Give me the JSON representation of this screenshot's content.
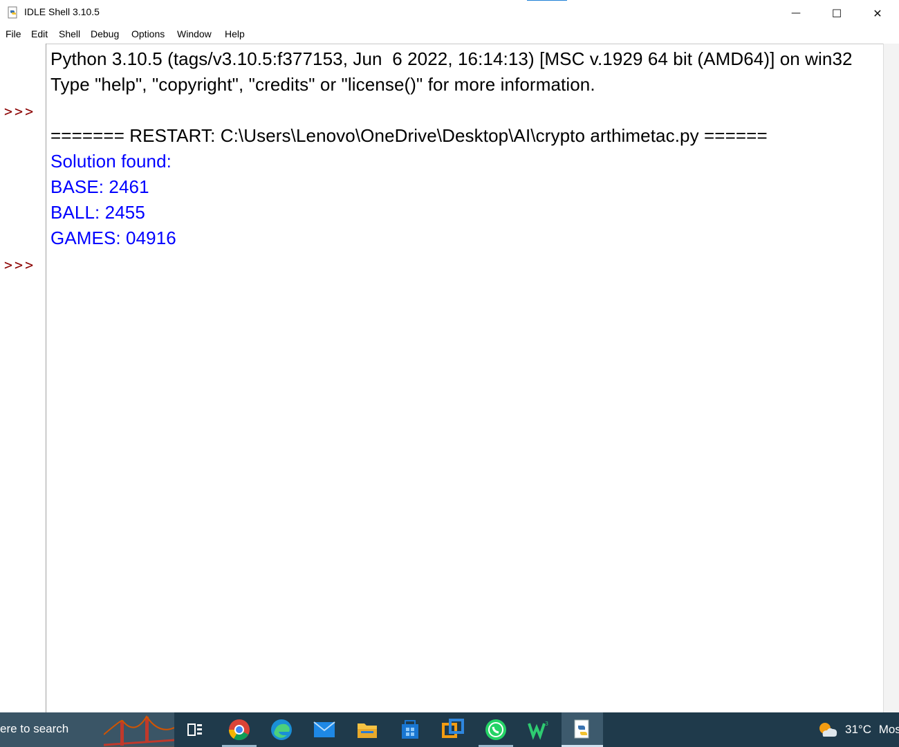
{
  "window": {
    "title": "IDLE Shell 3.10.5",
    "minimize_glyph": "—",
    "maximize_glyph": "☐",
    "close_glyph": "✕"
  },
  "menu": [
    "File",
    "Edit",
    "Shell",
    "Debug",
    "Options",
    "Window",
    "Help"
  ],
  "shell": {
    "prompt": ">>>",
    "banner_line1": "Python 3.10.5 (tags/v3.10.5:f377153, Jun  6 2022, 16:14:13) [MSC v.1929 64 bit (AMD64)] on win32",
    "banner_line2": "Type \"help\", \"copyright\", \"credits\" or \"license()\" for more information.",
    "restart_line": "======= RESTART: C:\\Users\\Lenovo\\OneDrive\\Desktop\\AI\\crypto arthimetac.py ======",
    "output": [
      "Solution found:",
      "BASE: 2461",
      "BALL: 2455",
      "GAMES: 04916"
    ],
    "colors": {
      "output": "#0000ff",
      "prompt": "#8b0000",
      "text": "#000000"
    }
  },
  "taskbar": {
    "search_text": "ere to search",
    "icons": [
      "task-view-icon",
      "chrome-icon",
      "edge-icon",
      "mail-icon",
      "file-explorer-icon",
      "store-icon",
      "vmware-icon",
      "whatsapp-icon",
      "wps-icon",
      "idle-icon"
    ],
    "weather_temp": "31°C",
    "weather_desc": "Mos"
  }
}
